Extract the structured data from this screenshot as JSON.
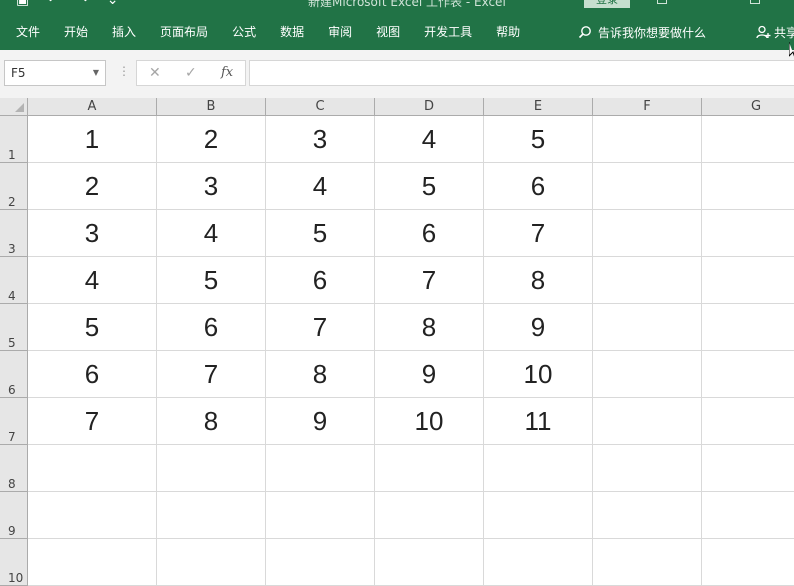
{
  "window": {
    "title": "新建Microsoft Excel 工作表 - Excel",
    "login_label": "登录"
  },
  "ribbon": {
    "tabs": [
      "文件",
      "开始",
      "插入",
      "页面布局",
      "公式",
      "数据",
      "审阅",
      "视图",
      "开发工具",
      "帮助"
    ],
    "tell_me": "告诉我你想要做什么",
    "share": "共享"
  },
  "formula_bar": {
    "name_box": "F5",
    "fx_label": "fx",
    "formula": ""
  },
  "grid": {
    "columns": [
      "A",
      "B",
      "C",
      "D",
      "E",
      "F",
      "G"
    ],
    "rows": [
      "1",
      "2",
      "3",
      "4",
      "5",
      "6",
      "7",
      "8",
      "9",
      "10"
    ],
    "cells": [
      [
        "1",
        "2",
        "3",
        "4",
        "5",
        "",
        ""
      ],
      [
        "2",
        "3",
        "4",
        "5",
        "6",
        "",
        ""
      ],
      [
        "3",
        "4",
        "5",
        "6",
        "7",
        "",
        ""
      ],
      [
        "4",
        "5",
        "6",
        "7",
        "8",
        "",
        ""
      ],
      [
        "5",
        "6",
        "7",
        "8",
        "9",
        "",
        ""
      ],
      [
        "6",
        "7",
        "8",
        "9",
        "10",
        "",
        ""
      ],
      [
        "7",
        "8",
        "9",
        "10",
        "11",
        "",
        ""
      ],
      [
        "",
        "",
        "",
        "",
        "",
        "",
        ""
      ],
      [
        "",
        "",
        "",
        "",
        "",
        "",
        ""
      ],
      [
        "",
        "",
        "",
        "",
        "",
        "",
        ""
      ]
    ]
  },
  "colors": {
    "ribbon_green": "#217346",
    "header_gray": "#e6e6e6",
    "gridline": "#d9d9d9"
  }
}
